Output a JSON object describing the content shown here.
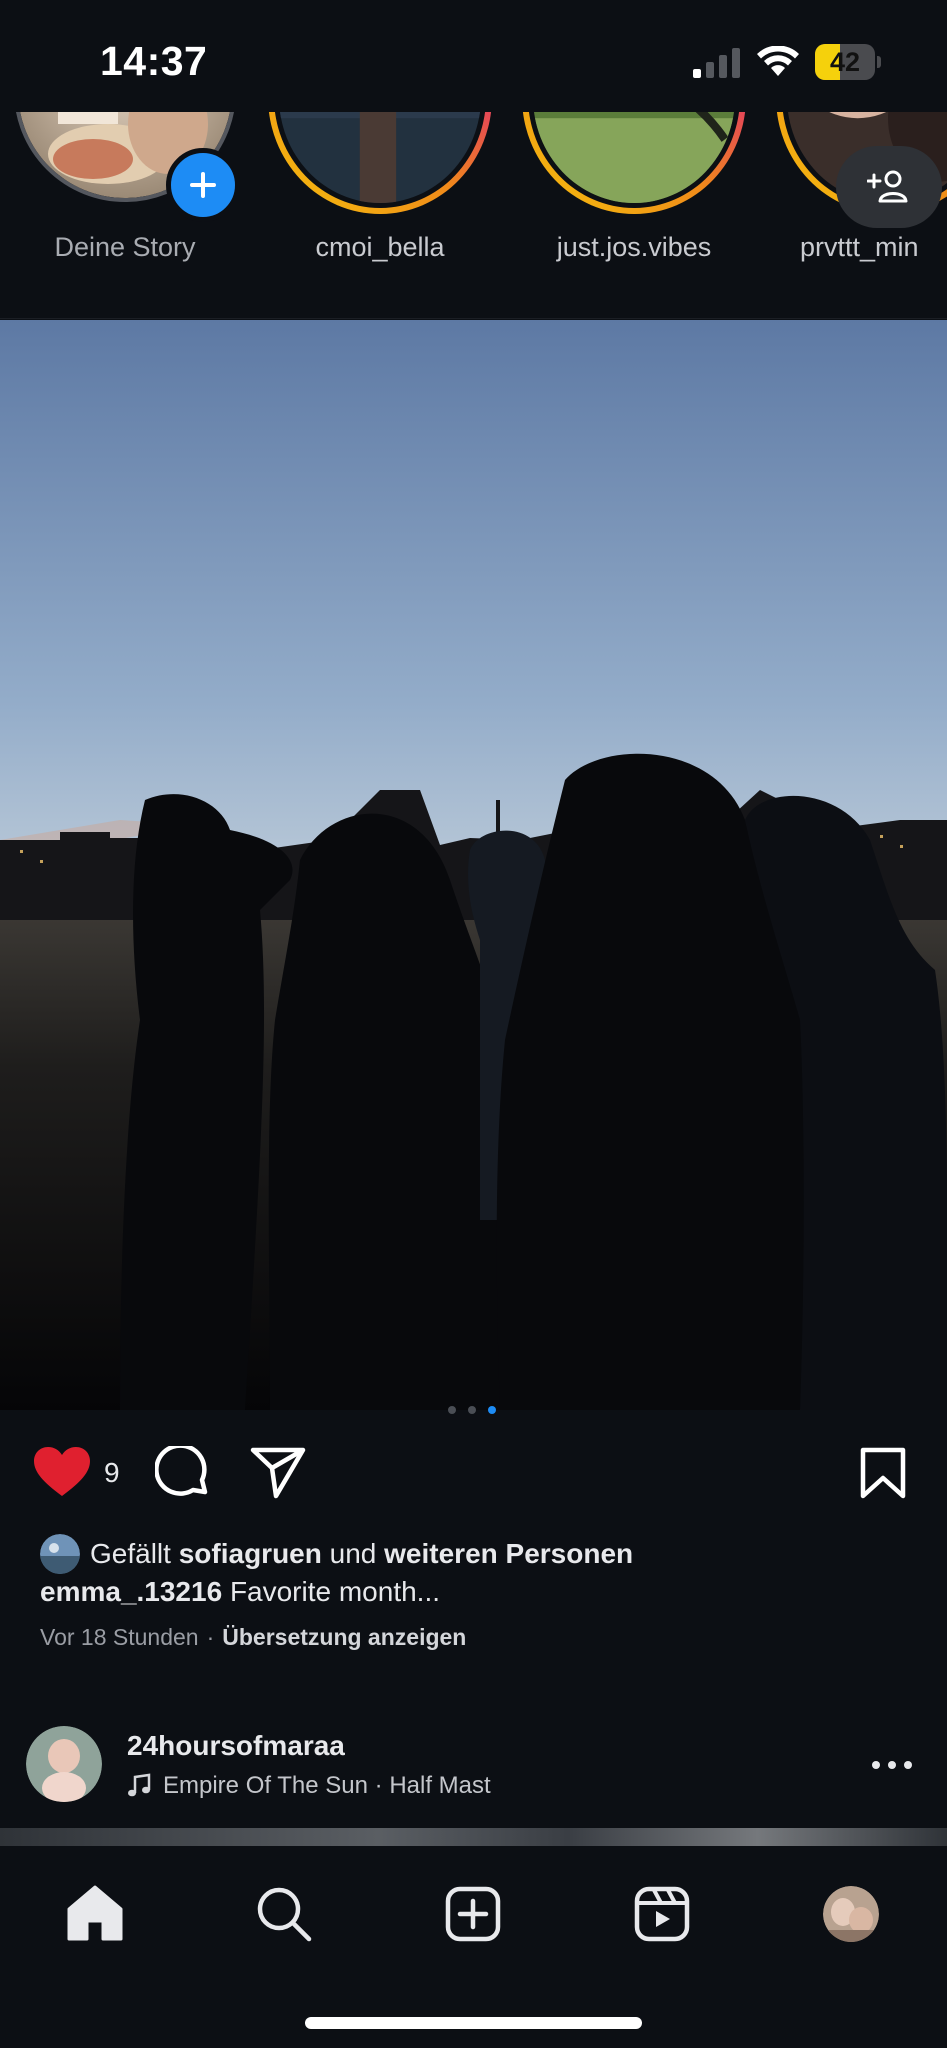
{
  "status_bar": {
    "time": "14:37",
    "battery_level": "42",
    "battery_fraction": 0.42,
    "signal_bars_active": 1,
    "accent_battery_color": "#f5d10c"
  },
  "stories": [
    {
      "username": "Deine Story",
      "is_own": true,
      "add_icon": "plus-icon"
    },
    {
      "username": "cmoi_bella",
      "is_own": false
    },
    {
      "username": "just.jos.vibes",
      "is_own": false
    },
    {
      "username": "prvttt_min",
      "is_own": false
    }
  ],
  "add_person_icon": "add-person-icon",
  "post": {
    "like_count": "9",
    "liked": true,
    "like_color": "#e0202f",
    "likes_prefix": "Gefällt",
    "likes_user": "sofiagruen",
    "likes_and": "und",
    "likes_others": "weiteren Personen",
    "caption_user": "emma_.13216",
    "caption_text": "Favorite month...",
    "time_ago": "Vor 18 Stunden",
    "separator": "·",
    "translate_label": "Übersetzung anzeigen",
    "carousel_pages": 3,
    "carousel_active": 3
  },
  "next_post": {
    "username": "24hoursofmaraa",
    "music": "Empire Of The Sun · Half Mast"
  },
  "tab_bar": {
    "items": [
      "home-icon",
      "search-icon",
      "create-icon",
      "reels-icon",
      "profile-avatar"
    ]
  }
}
